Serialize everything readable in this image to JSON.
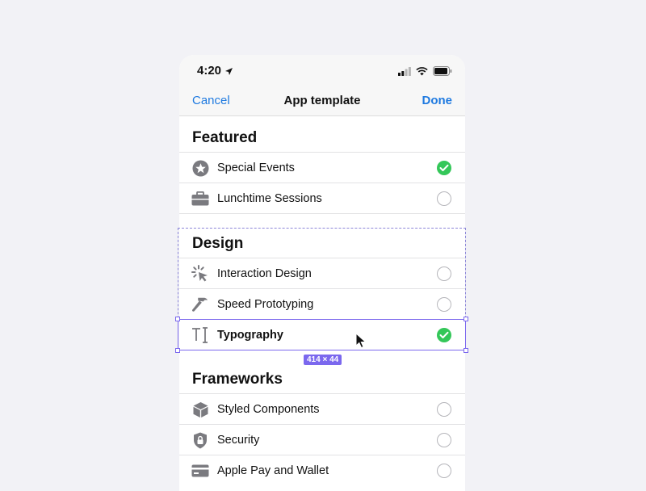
{
  "status_bar": {
    "time": "4:20"
  },
  "nav": {
    "cancel": "Cancel",
    "title": "App template",
    "done": "Done"
  },
  "sections": [
    {
      "title": "Featured",
      "items": [
        {
          "label": "Special Events",
          "icon": "star-circle-icon",
          "checked": true
        },
        {
          "label": "Lunchtime Sessions",
          "icon": "briefcase-icon",
          "checked": false
        }
      ]
    },
    {
      "title": "Design",
      "items": [
        {
          "label": "Interaction Design",
          "icon": "cursor-click-icon",
          "checked": false
        },
        {
          "label": "Speed Prototyping",
          "icon": "hammer-icon",
          "checked": false
        },
        {
          "label": "Typography",
          "icon": "text-cursor-icon",
          "checked": true
        }
      ]
    },
    {
      "title": "Frameworks",
      "items": [
        {
          "label": "Styled Components",
          "icon": "cube-icon",
          "checked": false
        },
        {
          "label": "Security",
          "icon": "shield-lock-icon",
          "checked": false
        },
        {
          "label": "Apple Pay and Wallet",
          "icon": "credit-card-icon",
          "checked": false
        }
      ]
    }
  ],
  "selection": {
    "dimensions": "414 × 44"
  },
  "colors": {
    "accent": "#1f7ae0",
    "check": "#34c759",
    "selection": "#7b68ee"
  }
}
